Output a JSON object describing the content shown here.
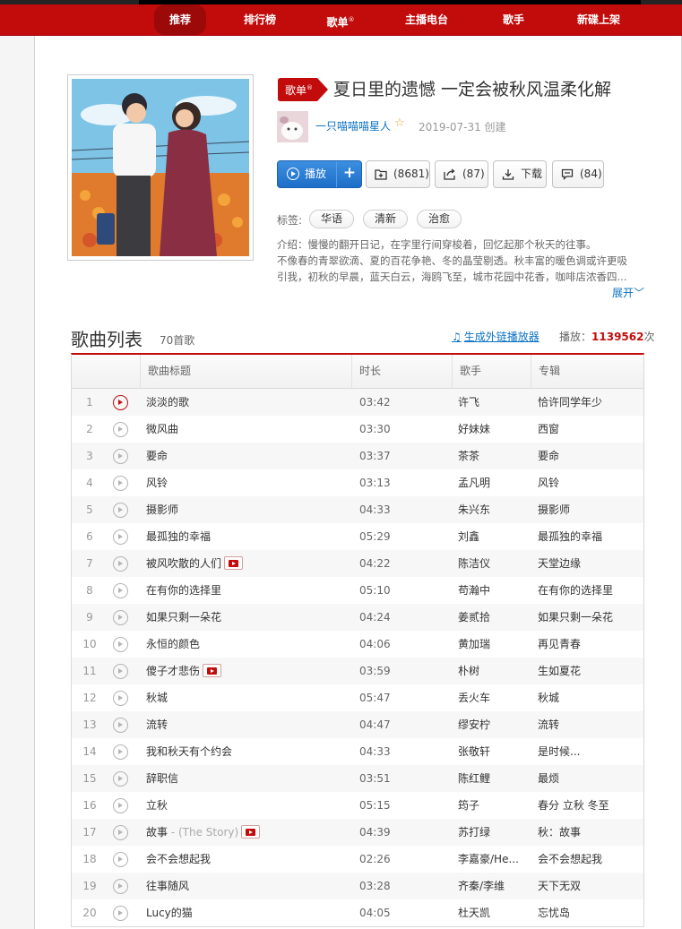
{
  "nav": {
    "items": [
      {
        "label": "推荐"
      },
      {
        "label": "排行榜"
      },
      {
        "label": "歌单",
        "sup": "®"
      },
      {
        "label": "主播电台"
      },
      {
        "label": "歌手"
      },
      {
        "label": "新碟上架"
      }
    ]
  },
  "playlist": {
    "badge": "歌单",
    "badge_sup": "®",
    "title": "夏日里的遗憾 一定会被秋风温柔化解",
    "creator": "一只喵喵喵星人",
    "created": "2019-07-31 创建",
    "actions": {
      "play": "播放",
      "add": "+",
      "collect": "(8681)",
      "share": "(87)",
      "download": "下载",
      "comment": "(84)"
    },
    "tags_label": "标签:",
    "tags": [
      "华语",
      "清新",
      "治愈"
    ],
    "description": [
      "介绍：慢慢的翻开日记，在字里行间穿梭着，回忆起那个秋天的往事。",
      "不像春的青翠欲滴、夏的百花争艳、冬的晶莹剔透。秋丰富的暖色调或许更吸",
      "引我，初秋的早晨，蓝天白云，海鸥飞至，城市花园中花香，咖啡店浓香四..."
    ],
    "expand": "展开"
  },
  "songlist": {
    "title": "歌曲列表",
    "count": "70首歌",
    "ext_link": "生成外链播放器",
    "play_label": "播放：",
    "play_count": "1139562",
    "play_unit": "次",
    "headers": {
      "title": "歌曲标题",
      "duration": "时长",
      "artist": "歌手",
      "album": "专辑"
    },
    "rows": [
      {
        "num": "1",
        "name": "淡淡的歌",
        "sub": "",
        "mv": false,
        "dur": "03:42",
        "artist": "许飞",
        "album": "恰许同学年少"
      },
      {
        "num": "2",
        "name": "微风曲",
        "sub": "",
        "mv": false,
        "dur": "03:30",
        "artist": "好妹妹",
        "album": "西窗"
      },
      {
        "num": "3",
        "name": "要命",
        "sub": "",
        "mv": false,
        "dur": "03:37",
        "artist": "茶茶",
        "album": "要命"
      },
      {
        "num": "4",
        "name": "风铃",
        "sub": "",
        "mv": false,
        "dur": "03:13",
        "artist": "孟凡明",
        "album": "风铃"
      },
      {
        "num": "5",
        "name": "摄影师",
        "sub": "",
        "mv": false,
        "dur": "04:33",
        "artist": "朱兴东",
        "album": "摄影师"
      },
      {
        "num": "6",
        "name": "最孤独的幸福",
        "sub": "",
        "mv": false,
        "dur": "05:29",
        "artist": "刘鑫",
        "album": "最孤独的幸福"
      },
      {
        "num": "7",
        "name": "被风吹散的人们",
        "sub": "",
        "mv": true,
        "dur": "04:22",
        "artist": "陈洁仪",
        "album": "天堂边缘"
      },
      {
        "num": "8",
        "name": "在有你的选择里",
        "sub": "",
        "mv": false,
        "dur": "05:10",
        "artist": "苟瀚中",
        "album": "在有你的选择里"
      },
      {
        "num": "9",
        "name": "如果只剩一朵花",
        "sub": "",
        "mv": false,
        "dur": "04:24",
        "artist": "姜贰拾",
        "album": "如果只剩一朵花"
      },
      {
        "num": "10",
        "name": "永恒的颜色",
        "sub": "",
        "mv": false,
        "dur": "04:06",
        "artist": "黄加瑞",
        "album": "再见青春"
      },
      {
        "num": "11",
        "name": "傻子才悲伤",
        "sub": "",
        "mv": true,
        "dur": "03:59",
        "artist": "朴树",
        "album": "生如夏花"
      },
      {
        "num": "12",
        "name": "秋城",
        "sub": "",
        "mv": false,
        "dur": "05:47",
        "artist": "丢火车",
        "album": "秋城"
      },
      {
        "num": "13",
        "name": "流转",
        "sub": "",
        "mv": false,
        "dur": "04:47",
        "artist": "缪安柠",
        "album": "流转"
      },
      {
        "num": "14",
        "name": "我和秋天有个约会",
        "sub": "",
        "mv": false,
        "dur": "04:33",
        "artist": "张敬轩",
        "album": "是时候..."
      },
      {
        "num": "15",
        "name": "辞职信",
        "sub": "",
        "mv": false,
        "dur": "03:51",
        "artist": "陈红鲤",
        "album": "最烦"
      },
      {
        "num": "16",
        "name": "立秋",
        "sub": "",
        "mv": false,
        "dur": "05:15",
        "artist": "筠子",
        "album": "春分 立秋 冬至"
      },
      {
        "num": "17",
        "name": "故事",
        "sub": " - (The Story)",
        "mv": true,
        "dur": "04:39",
        "artist": "苏打绿",
        "album": "秋：故事"
      },
      {
        "num": "18",
        "name": "会不会想起我",
        "sub": "",
        "mv": false,
        "dur": "02:26",
        "artist": "李嘉豪/He...",
        "album": "会不会想起我"
      },
      {
        "num": "19",
        "name": "往事随风",
        "sub": "",
        "mv": false,
        "dur": "03:28",
        "artist": "齐秦/李维",
        "album": "天下无双"
      },
      {
        "num": "20",
        "name": "Lucy的猫",
        "sub": "",
        "mv": false,
        "dur": "04:05",
        "artist": "杜天凯",
        "album": "忘忧岛"
      }
    ]
  }
}
